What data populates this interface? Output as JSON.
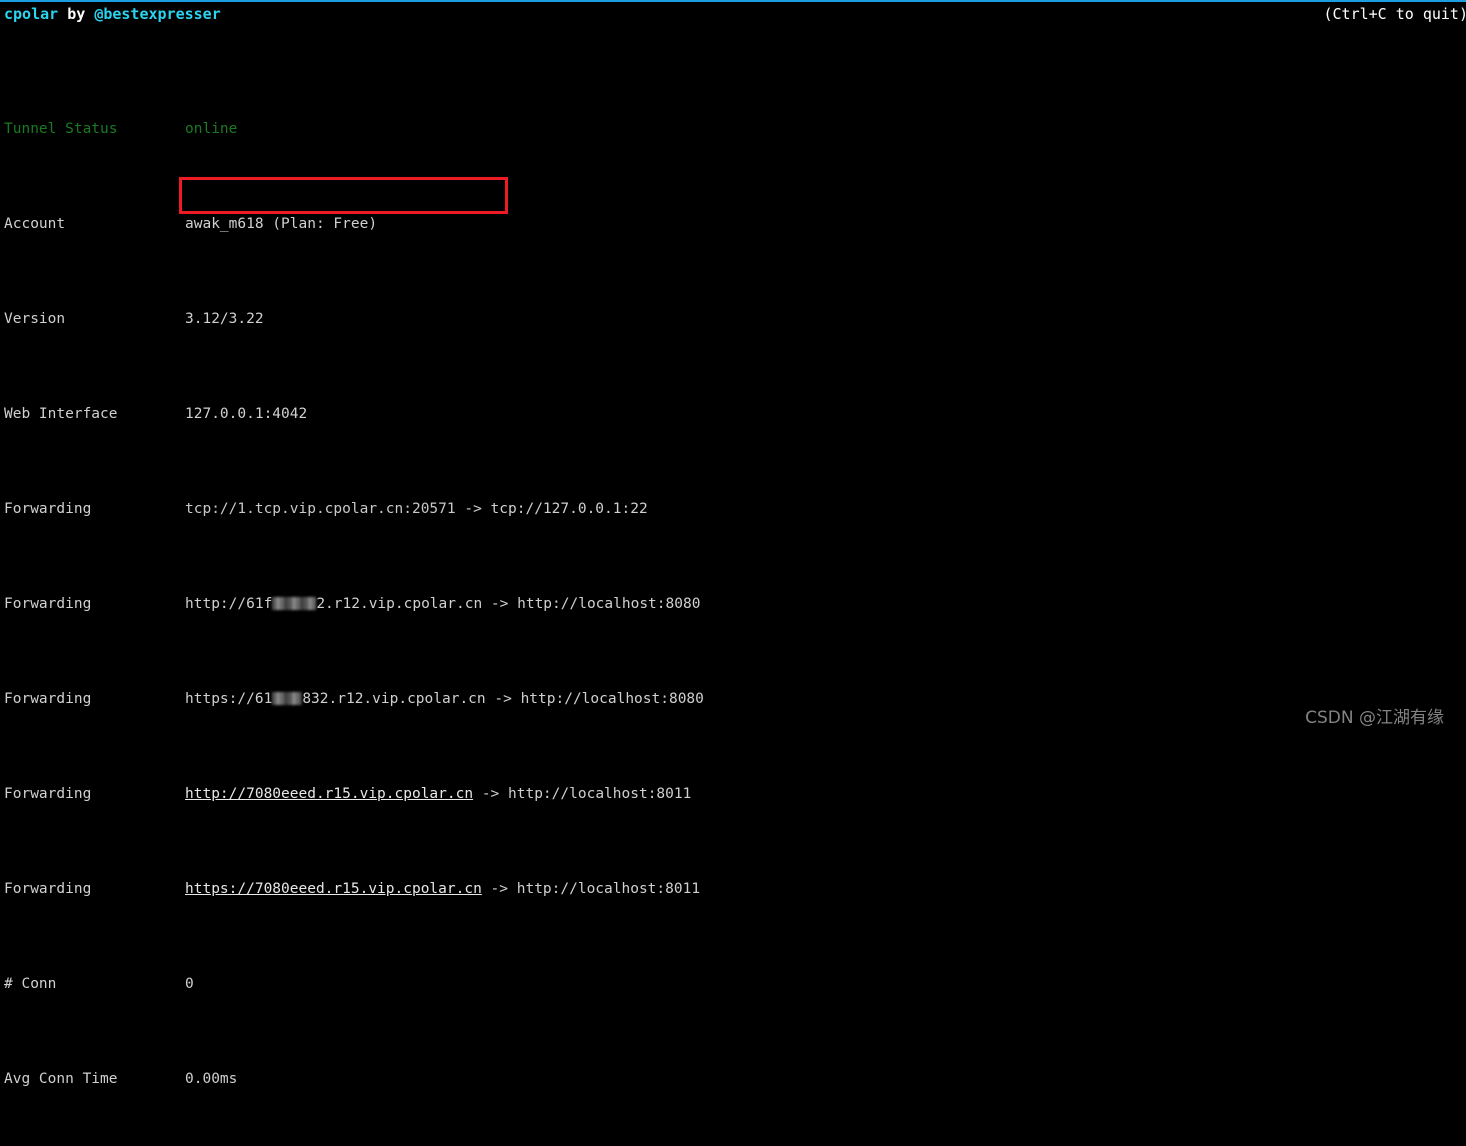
{
  "window": {
    "title": "cpolar by @bestexpresser",
    "brand": "cpolar",
    "by_word": "by",
    "handle": "@bestexpresser",
    "quit_hint": "(Ctrl+C to quit)",
    "top_rule_color": "#1a9ee0",
    "brand_color": "#2ad4f0",
    "background_color": "#000000",
    "text_color": "#d0d0d0",
    "status_color": "#1a7a22",
    "annotation_color": "#ed1c24"
  },
  "status_table": {
    "rows": [
      {
        "label": "Tunnel Status",
        "value": "online",
        "kind": "status"
      },
      {
        "label": "Account",
        "value": "awak_m618 (Plan: Free)",
        "kind": "plain"
      },
      {
        "label": "Version",
        "value": "3.12/3.22",
        "kind": "plain"
      },
      {
        "label": "Web Interface",
        "value": "127.0.0.1:4042",
        "kind": "plain"
      },
      {
        "label": "Forwarding",
        "source": "tcp://1.tcp.vip.cpolar.cn:20571",
        "arrow": " -> ",
        "destination": "tcp://127.0.0.1:22",
        "kind": "forward"
      },
      {
        "label": "Forwarding",
        "source_prefix": "http://61f",
        "source_suffix": "2.r12.vip.cpolar.cn",
        "redacted": true,
        "arrow": " -> ",
        "destination": "http://localhost:8080",
        "kind": "forward-redacted"
      },
      {
        "label": "Forwarding",
        "source_prefix": "https://61",
        "source_suffix": "832.r12.vip.cpolar.cn",
        "redacted": true,
        "arrow": " -> ",
        "destination": "http://localhost:8080",
        "kind": "forward-redacted"
      },
      {
        "label": "Forwarding",
        "source": "http://7080eeed.r15.vip.cpolar.cn",
        "arrow": " -> ",
        "destination": "http://localhost:8011",
        "kind": "forward-highlighted"
      },
      {
        "label": "Forwarding",
        "source": "https://7080eeed.r15.vip.cpolar.cn",
        "arrow": " -> ",
        "destination": "http://localhost:8011",
        "kind": "forward-highlighted"
      },
      {
        "label": "# Conn",
        "value": "0",
        "kind": "plain"
      },
      {
        "label": "Avg Conn Time",
        "value": "0.00ms",
        "kind": "plain"
      }
    ]
  },
  "annotation": {
    "shape": "rectangle",
    "color": "#ed1c24",
    "covers": "Forwarding rows for 7080eeed.r15.vip.cpolar.cn"
  },
  "watermark": {
    "text": "CSDN @江湖有缘"
  }
}
